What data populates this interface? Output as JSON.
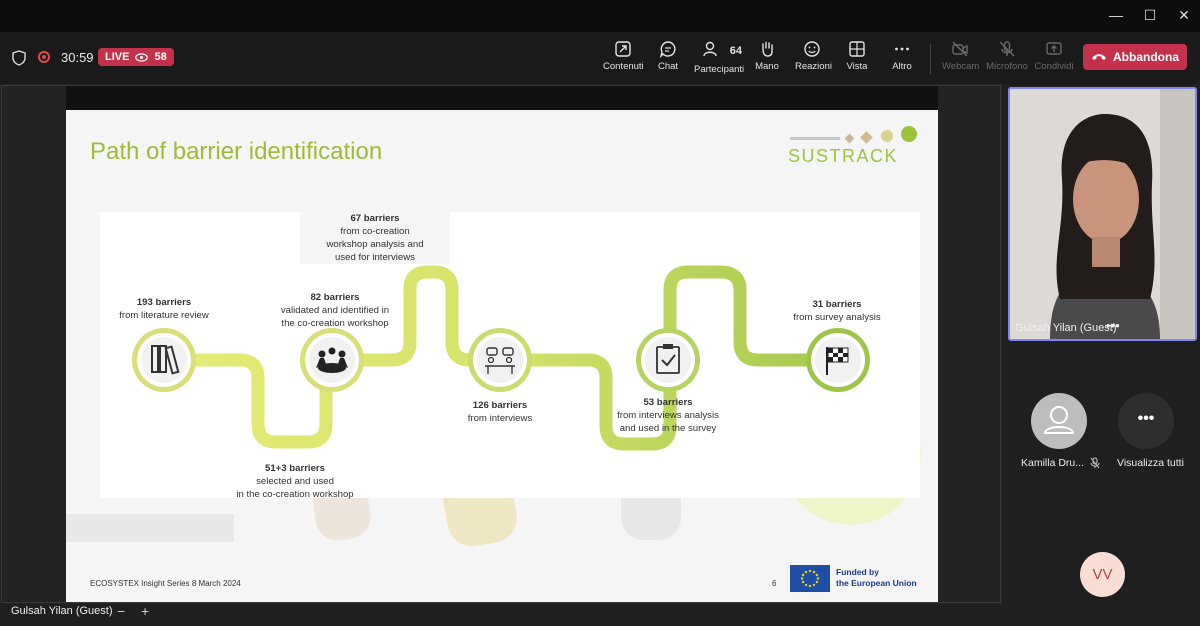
{
  "window": {
    "minimize_glyph": "—",
    "maximize_glyph": "☐",
    "close_glyph": "✕"
  },
  "meeting": {
    "timer": "30:59",
    "live_label": "LIVE",
    "viewer_count": "58"
  },
  "toolbar": {
    "contenuti": "Contenuti",
    "chat": "Chat",
    "participants_count": "64",
    "partecipanti": "Partecipanti",
    "mano": "Mano",
    "reazioni": "Reazioni",
    "vista": "Vista",
    "altro": "Altro",
    "webcam": "Webcam",
    "microfono": "Microfono",
    "condividi": "Condividi",
    "leave": "Abbandona"
  },
  "slide": {
    "title": "Path of barrier identification",
    "logo": "SUSTRACK",
    "steps": [
      {
        "count": "193 barriers",
        "desc": "from literature review"
      },
      {
        "count": "51+3 barriers",
        "desc": "selected and used\nin the co-creation workshop"
      },
      {
        "count": "82 barriers",
        "desc": "validated and identified in\nthe co-creation workshop"
      },
      {
        "count": "67 barriers",
        "desc": "from co-creation\nworkshop analysis and\nused for interviews"
      },
      {
        "count": "126 barriers",
        "desc": "from interviews"
      },
      {
        "count": "53 barriers",
        "desc": "from interviews analysis\nand used in the survey"
      },
      {
        "count": "31 barriers",
        "desc": "from survey analysis"
      }
    ],
    "footer": "ECOSYSTEX Insight Series 8 March 2024",
    "page": "6",
    "eu_line1": "Funded by",
    "eu_line2": "the European Union",
    "colors": {
      "green": "#9dbb35",
      "path_yellow": "#e3e96c",
      "path_green": "#9fc64a"
    }
  },
  "stage": {
    "speaker_name": "Gulsah Yilan (Guest)",
    "zoom_out": "−",
    "zoom_in": "+"
  },
  "participants": {
    "self_name": "Gulsah Yilan (Guest)",
    "tile_more": "•••",
    "p1_name": "Kamilla Dru...",
    "more_label": "Visualizza tutti",
    "more_glyph": "•••",
    "initials": "VV"
  }
}
